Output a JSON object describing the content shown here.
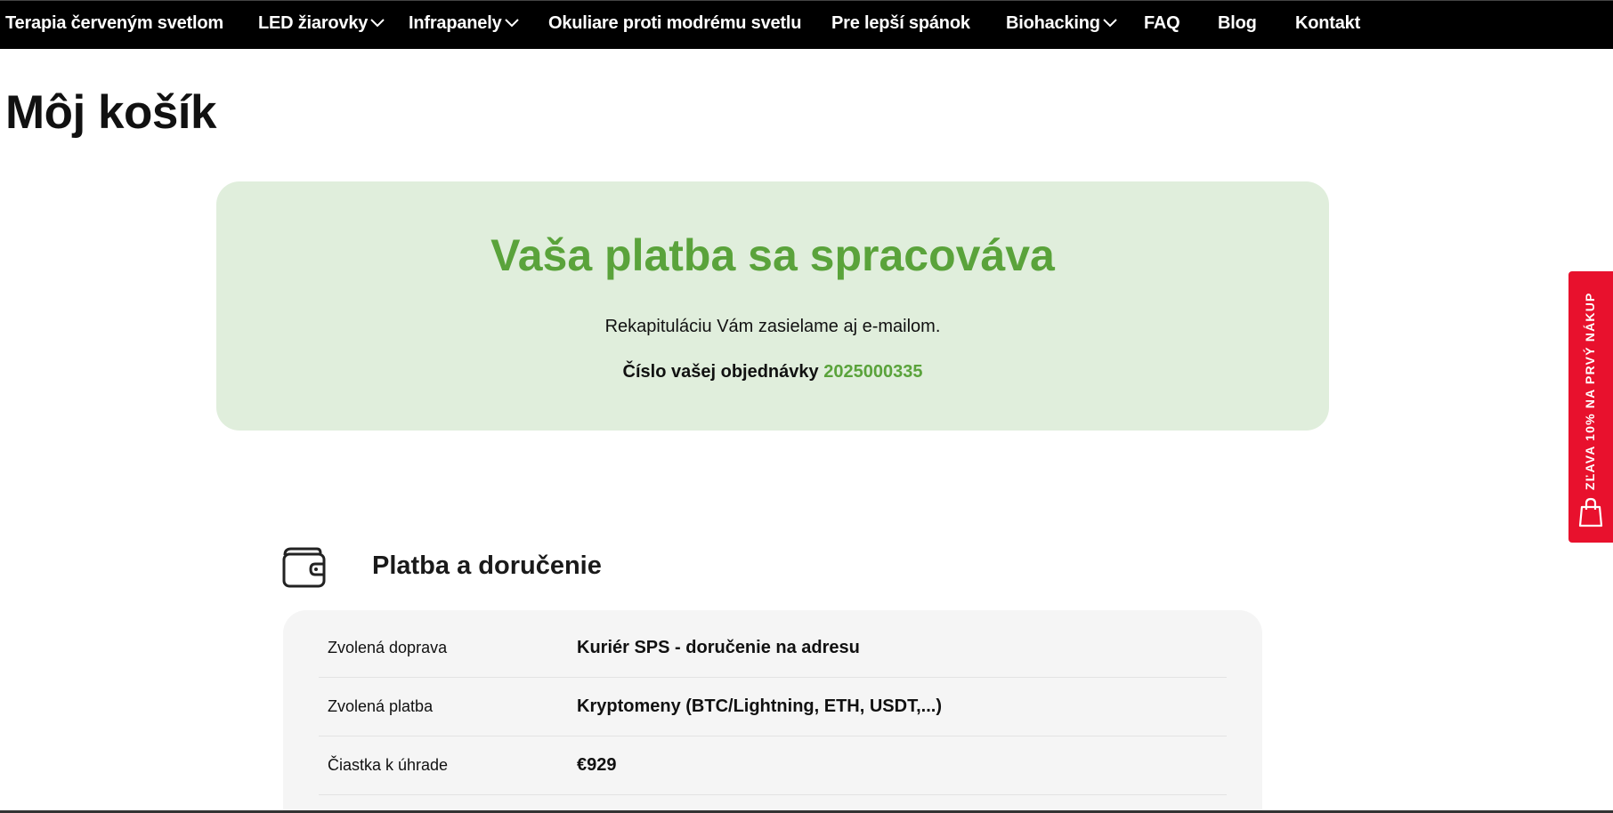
{
  "nav": {
    "items": [
      {
        "label": "Terapia červeným svetlom",
        "has_dropdown": false
      },
      {
        "label": "LED žiarovky",
        "has_dropdown": true
      },
      {
        "label": "Infrapanely",
        "has_dropdown": true
      },
      {
        "label": "Okuliare proti modrému svetlu",
        "has_dropdown": false
      },
      {
        "label": "Pre lepší spánok",
        "has_dropdown": false
      },
      {
        "label": "Biohacking",
        "has_dropdown": true
      },
      {
        "label": "FAQ",
        "has_dropdown": false
      },
      {
        "label": "Blog",
        "has_dropdown": false
      },
      {
        "label": "Kontakt",
        "has_dropdown": false
      }
    ]
  },
  "page": {
    "title": "Môj košík"
  },
  "status": {
    "heading": "Vaša platba sa spracováva",
    "note": "Rekapituláciu Vám zasielame aj e-mailom.",
    "order_label": "Číslo vašej objednávky",
    "order_number": "2025000335"
  },
  "payment_section": {
    "icon": "wallet-icon",
    "title": "Platba a doručenie",
    "rows": [
      {
        "label": "Zvolená doprava",
        "value": "Kuriér SPS - doručenie na adresu"
      },
      {
        "label": "Zvolená platba",
        "value": "Kryptomeny (BTC/Lightning, ETH, USDT,...)"
      },
      {
        "label": "Čiastka k úhrade",
        "value": "€929"
      }
    ]
  },
  "promo": {
    "label": "ZĽAVA 10% NA PRVÝ NÁKUP",
    "icon": "shopping-bag-icon"
  },
  "colors": {
    "nav_bg": "#000000",
    "accent_green": "#5aa33b",
    "status_bg": "#e0eedc",
    "promo_red": "#e8112d",
    "details_bg": "#f5f5f5"
  }
}
